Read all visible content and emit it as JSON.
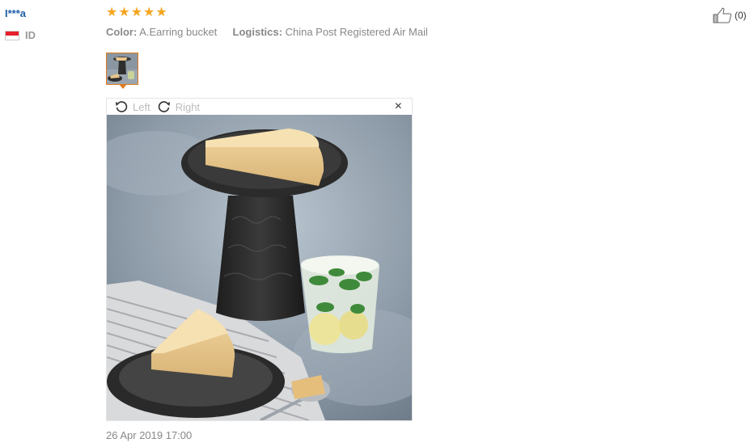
{
  "reviewer": {
    "name": "I***a",
    "country_code": "ID"
  },
  "rating": {
    "stars": 5,
    "max": 5
  },
  "attributes": {
    "color_label": "Color:",
    "color_value": "A.Earring bucket",
    "logistics_label": "Logistics:",
    "logistics_value": "China Post Registered Air Mail"
  },
  "helpful": {
    "count": "(0)",
    "icon": "thumbs-up-icon"
  },
  "viewer": {
    "rotate_left_label": "Left",
    "rotate_right_label": "Right",
    "close_label": "×"
  },
  "date": "26 Apr 2019 17:00",
  "colors": {
    "star": "#f5a623",
    "accent": "#e07b1f",
    "name_link": "#1f5fa8"
  }
}
